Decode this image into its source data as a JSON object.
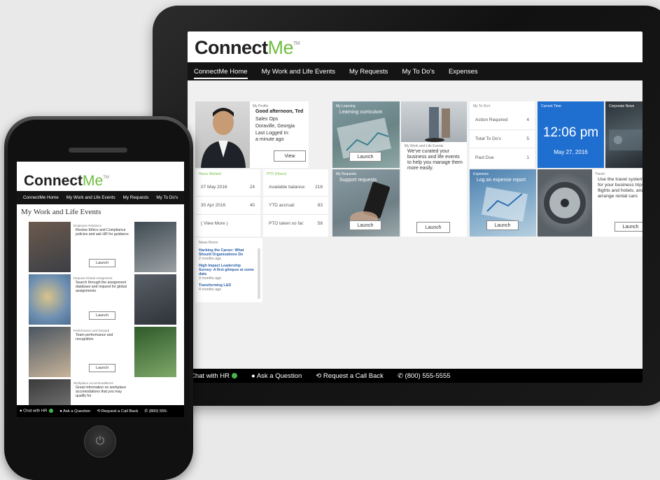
{
  "tablet": {
    "logo": {
      "bold": "Connect",
      "light": "Me",
      "tm": "TM"
    },
    "nav": [
      "ConnectMe Home",
      "My Work and Life Events",
      "My Requests",
      "My To Do's",
      "Expenses"
    ],
    "profile": {
      "caption": "My Profile",
      "greeting": "Good afternoon, Ted",
      "role": "Sales Ops",
      "location": "Doraville, Georgia",
      "last_login_label": "Last Logged In:",
      "last_login_value": "a minute ago",
      "button": "View"
    },
    "learning": {
      "caption": "My Learning",
      "title": "Learning curriculum",
      "button": "Launch"
    },
    "work_life": {
      "caption": "My Work and Life Events",
      "text": "We've curated your business and life events to help you manage them more easily.",
      "button": "Launch"
    },
    "todos": {
      "caption": "My To Do's",
      "rows": [
        {
          "label": "Action Required",
          "value": "4"
        },
        {
          "label": "Total To Do's",
          "value": "5"
        },
        {
          "label": "Past Due",
          "value": "1"
        }
      ]
    },
    "time": {
      "caption": "Current Time",
      "clock": "12:06 pm",
      "date": "May 27, 2016"
    },
    "news_tile": {
      "caption": "Corporate News"
    },
    "hours": {
      "caption": "Hours Worked",
      "rows": [
        {
          "date": "07 May 2016",
          "value": "24"
        },
        {
          "date": "30 Apr 2016",
          "value": "40"
        }
      ],
      "more": "( View More )"
    },
    "pto": {
      "caption": "PTO (Hours)",
      "rows": [
        {
          "label": "Available balance:",
          "value": "218"
        },
        {
          "label": "YTD accrual:",
          "value": "83"
        },
        {
          "label": "PTO taken so far:",
          "value": "58"
        }
      ]
    },
    "requests": {
      "caption": "My Requests",
      "title": "Support requests",
      "button": "Launch"
    },
    "expenses": {
      "caption": "Expenses",
      "title": "Log an expense report",
      "button": "Launch"
    },
    "travel": {
      "caption": "Travel",
      "text": "Use the travel system for your business trips, flights and hotels, and arrange rental cars",
      "button": "Launch"
    },
    "newsroom": {
      "caption": "News Room",
      "items": [
        {
          "title": "Hacking the Career: What Should Organizations Do",
          "time": "2 months ago"
        },
        {
          "title": "High Impact Leadership Survey: A first glimpse at some data",
          "time": "3 months ago"
        },
        {
          "title": "Transforming L&D",
          "time": "4 months ago"
        }
      ]
    },
    "footer": [
      "Chat with HR",
      "Ask a Question",
      "Request a Call Back",
      "(800) 555-5555"
    ]
  },
  "phone": {
    "logo": {
      "bold": "Connect",
      "light": "Me",
      "tm": "TM"
    },
    "nav": [
      "ConnectMe Home",
      "My Work and Life Events",
      "My Requests",
      "My To Do's"
    ],
    "title": "My Work and Life Events",
    "cards": [
      {
        "category": "Employee Relations",
        "text": "Review Ethics and Compliance policies and ask HR for guidance",
        "button": "Launch"
      },
      {
        "category": "Request Global Assignment",
        "text": "Search through the assignment database and request for global assignments",
        "button": "Launch"
      },
      {
        "category": "Performance and Reward",
        "text": "Team performance and recognition",
        "button": "Launch"
      },
      {
        "category": "Workplace Accommodations",
        "text": "Great information on workplace accomodations that you may qualify for"
      }
    ],
    "footer": [
      "Chat with HR",
      "Ask a Question",
      "Request a Call Back",
      "(800) 555-"
    ]
  },
  "colors": {
    "brand_green": "#6fbd3f",
    "time_blue": "#1f6fd1",
    "nav_black": "#141414",
    "status_green": "#44b649"
  }
}
